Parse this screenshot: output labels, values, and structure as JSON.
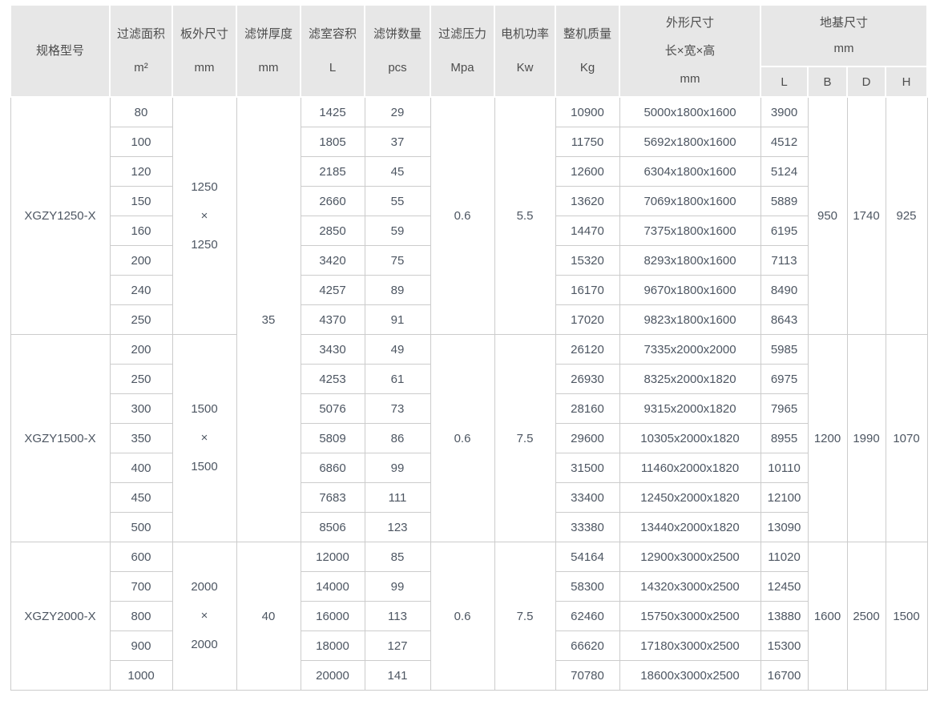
{
  "header": {
    "model": "规格型号",
    "cols": [
      {
        "label": "过滤面积",
        "unit": "m²"
      },
      {
        "label": "板外尺寸",
        "unit": "mm"
      },
      {
        "label": "滤饼厚度",
        "unit": "mm"
      },
      {
        "label": "滤室容积",
        "unit": "L"
      },
      {
        "label": "滤饼数量",
        "unit": "pcs"
      },
      {
        "label": "过滤压力",
        "unit": "Mpa"
      },
      {
        "label": "电机功率",
        "unit": "Kw"
      },
      {
        "label": "整机质量",
        "unit": "Kg"
      }
    ],
    "dims": {
      "label": "外形尺寸",
      "sub": "长×宽×高",
      "unit": "mm"
    },
    "foundation": {
      "label": "地基尺寸",
      "unit": "mm",
      "subcols": [
        "L",
        "B",
        "D",
        "H"
      ]
    }
  },
  "colors": {
    "header_bg": "#e7e7e7",
    "header_text": "#4d4d4d",
    "body_text": "#4d5662",
    "border": "#cccccc"
  },
  "groups": [
    {
      "model": "XGZY1250-X",
      "plate_size": [
        "1250",
        "×",
        "1250"
      ],
      "cake_thickness": {
        "value": "35",
        "rowspan": 15
      },
      "pressure": "0.6",
      "power": "5.5",
      "foundation": {
        "B": "950",
        "D": "1740",
        "H": "925"
      },
      "rows": [
        [
          "80",
          "1425",
          "29",
          "10900",
          "5000x1800x1600",
          "3900"
        ],
        [
          "100",
          "1805",
          "37",
          "11750",
          "5692x1800x1600",
          "4512"
        ],
        [
          "120",
          "2185",
          "45",
          "12600",
          "6304x1800x1600",
          "5124"
        ],
        [
          "150",
          "2660",
          "55",
          "13620",
          "7069x1800x1600",
          "5889"
        ],
        [
          "160",
          "2850",
          "59",
          "14470",
          "7375x1800x1600",
          "6195"
        ],
        [
          "200",
          "3420",
          "75",
          "15320",
          "8293x1800x1600",
          "7113"
        ],
        [
          "240",
          "4257",
          "89",
          "16170",
          "9670x1800x1600",
          "8490"
        ],
        [
          "250",
          "4370",
          "91",
          "17020",
          "9823x1800x1600",
          "8643"
        ]
      ]
    },
    {
      "model": "XGZY1500-X",
      "plate_size": [
        "1500",
        "×",
        "1500"
      ],
      "cake_thickness": null,
      "pressure": "0.6",
      "power": "7.5",
      "foundation": {
        "B": "1200",
        "D": "1990",
        "H": "1070"
      },
      "rows": [
        [
          "200",
          "3430",
          "49",
          "26120",
          "7335x2000x2000",
          "5985"
        ],
        [
          "250",
          "4253",
          "61",
          "26930",
          "8325x2000x1820",
          "6975"
        ],
        [
          "300",
          "5076",
          "73",
          "28160",
          "9315x2000x1820",
          "7965"
        ],
        [
          "350",
          "5809",
          "86",
          "29600",
          "10305x2000x1820",
          "8955"
        ],
        [
          "400",
          "6860",
          "99",
          "31500",
          "11460x2000x1820",
          "10110"
        ],
        [
          "450",
          "7683",
          "111",
          "33400",
          "12450x2000x1820",
          "12100"
        ],
        [
          "500",
          "8506",
          "123",
          "33380",
          "13440x2000x1820",
          "13090"
        ]
      ]
    },
    {
      "model": "XGZY2000-X",
      "plate_size": [
        "2000",
        "×",
        "2000"
      ],
      "cake_thickness": {
        "value": "40",
        "rowspan": 5
      },
      "pressure": "0.6",
      "power": "7.5",
      "foundation": {
        "B": "1600",
        "D": "2500",
        "H": "1500"
      },
      "rows": [
        [
          "600",
          "12000",
          "85",
          "54164",
          "12900x3000x2500",
          "11020"
        ],
        [
          "700",
          "14000",
          "99",
          "58300",
          "14320x3000x2500",
          "12450"
        ],
        [
          "800",
          "16000",
          "113",
          "62460",
          "15750x3000x2500",
          "13880"
        ],
        [
          "900",
          "18000",
          "127",
          "66620",
          "17180x3000x2500",
          "15300"
        ],
        [
          "1000",
          "20000",
          "141",
          "70780",
          "18600x3000x2500",
          "16700"
        ]
      ]
    }
  ]
}
